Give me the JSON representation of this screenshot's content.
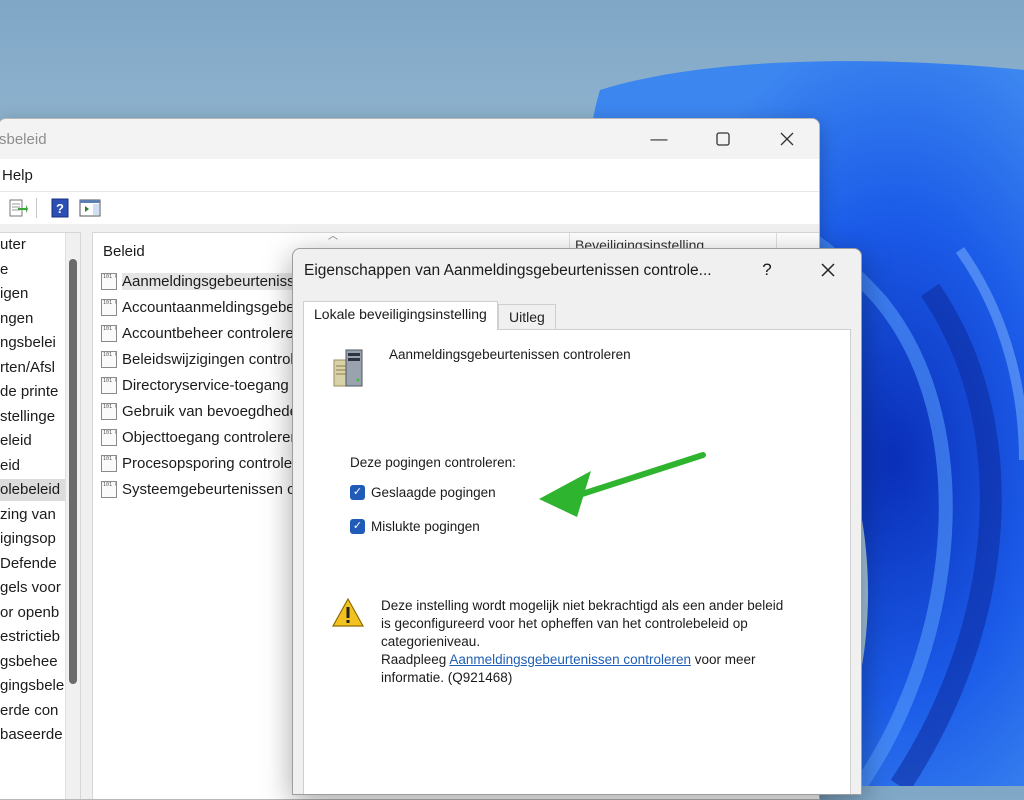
{
  "window": {
    "title": "sbeleid",
    "menu": {
      "help": "Help"
    }
  },
  "tree": {
    "items": [
      "uter",
      "e",
      "igen",
      "ngen",
      "ngsbelei",
      "rten/Afsl",
      "de printe",
      "stellinge",
      "eleid",
      "eid",
      "olebeleid",
      "zing van",
      "igingsop",
      "Defende",
      "gels voor",
      "or openb",
      "estrictieb",
      "gsbehee",
      "gingsbele",
      "erde con",
      "baseerde"
    ],
    "selected_index": 10
  },
  "list": {
    "column_policy": "Beleid",
    "column_setting": "Beveiligingsinstelling",
    "items": [
      "Aanmeldingsgebeurtenissen controleren",
      "Accountaanmeldingsgebeurtenissen controleren",
      "Accountbeheer controleren",
      "Beleidswijzigingen controleren",
      "Directoryservice-toegang controleren",
      "Gebruik van bevoegdheden controleren",
      "Objecttoegang controleren",
      "Procesopsporing controleren",
      "Systeemgebeurtenissen controleren"
    ],
    "selected_index": 0
  },
  "dialog": {
    "title": "Eigenschappen van Aanmeldingsgebeurtenissen controle...",
    "help_button": "?",
    "close_button": "✕",
    "tabs": [
      "Lokale beveiligingsinstelling",
      "Uitleg"
    ],
    "policy_name": "Aanmeldingsgebeurtenissen controleren",
    "group_label": "Deze pogingen controleren:",
    "checkboxes": [
      {
        "label": "Geslaagde pogingen",
        "checked": true
      },
      {
        "label": "Mislukte pogingen",
        "checked": true
      }
    ],
    "warning": {
      "line1": "Deze instelling wordt mogelijk niet bekrachtigd als een ander beleid",
      "line2": "is geconfigureerd voor het opheffen van het controlebeleid op",
      "line3": "categorieniveau.",
      "pre_link": "Raadpleeg ",
      "link": "Aanmeldingsgebeurtenissen controleren",
      "post_link": " voor meer",
      "line5": "informatie. (Q921468)"
    }
  },
  "colors": {
    "accent": "#1f5bb7",
    "annotation_arrow": "#2fb42f",
    "link": "#1f5fb5"
  }
}
